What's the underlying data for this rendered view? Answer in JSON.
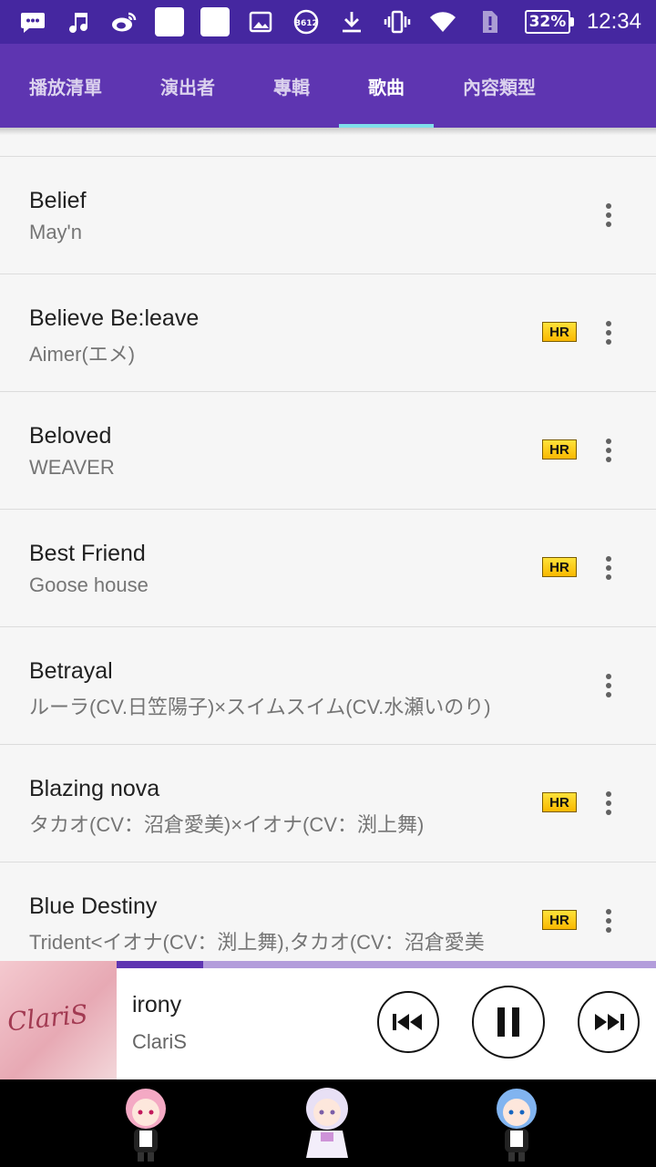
{
  "status_bar": {
    "icons_left": [
      "message-icon",
      "music-note-icon",
      "weibo-icon",
      "square-app-icon",
      "square-app-icon",
      "image-icon",
      "b612-icon",
      "download-icon",
      "vibrate-icon",
      "wifi-icon",
      "sim-alert-icon"
    ],
    "battery": "32%",
    "time": "12:34"
  },
  "tabs": [
    {
      "label": "播放清單",
      "active": false
    },
    {
      "label": "演出者",
      "active": false
    },
    {
      "label": "專輯",
      "active": false
    },
    {
      "label": "歌曲",
      "active": true
    },
    {
      "label": "內容類型",
      "active": false
    }
  ],
  "songs": [
    {
      "title": "Belief",
      "artist": "May'n",
      "hr": false
    },
    {
      "title": "Believe Be:leave",
      "artist": "Aimer(エメ)",
      "hr": true
    },
    {
      "title": "Beloved",
      "artist": "WEAVER",
      "hr": true
    },
    {
      "title": "Best Friend",
      "artist": "Goose house",
      "hr": true
    },
    {
      "title": "Betrayal",
      "artist": "ルーラ(CV.日笠陽子)×スイムスイム(CV.水瀬いのり)",
      "hr": false
    },
    {
      "title": "Blazing nova",
      "artist": "タカオ(CV：沼倉愛美)×イオナ(CV：渕上舞)",
      "hr": true
    },
    {
      "title": "Blue Destiny",
      "artist": "Trident<イオナ(CV：渕上舞),タカオ(CV：沼倉愛美",
      "hr": true
    }
  ],
  "hr_badge_label": "HR",
  "now_playing": {
    "title": "irony",
    "artist": "ClariS",
    "album_art_text": "ClariS",
    "progress_percent": 16
  },
  "colors": {
    "status_bar": "#4527A0",
    "tab_bar": "#5E35B1",
    "tab_indicator": "#80DEEA",
    "progress": "#5E35B1"
  }
}
